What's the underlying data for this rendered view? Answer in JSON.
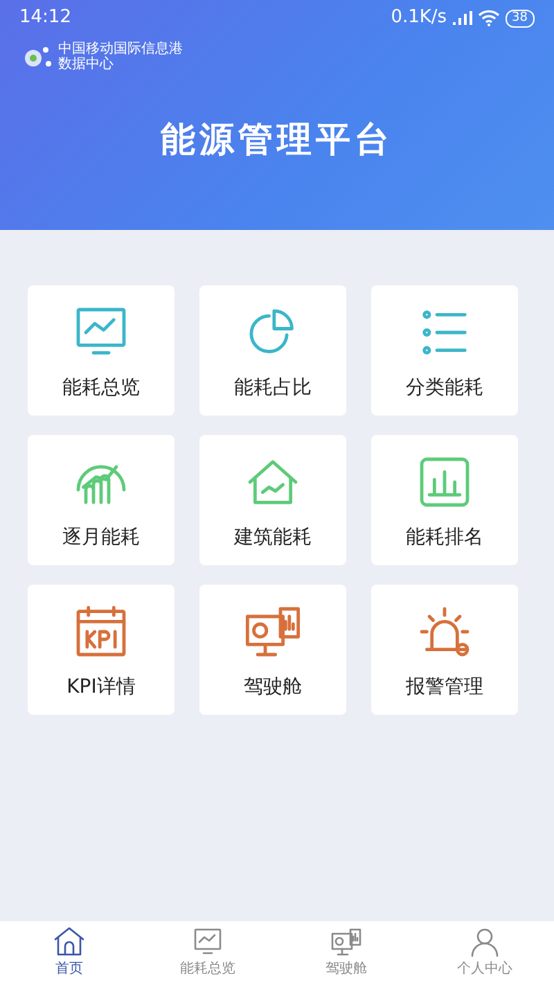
{
  "status_bar": {
    "time": "14:12",
    "speed": "0.1K/s",
    "battery": "38"
  },
  "header": {
    "logo_line_1": "中国移动国际信息港",
    "logo_line_2": "数据中心",
    "title": "能源管理平台"
  },
  "tiles": [
    {
      "label": "能耗总览",
      "kind": "monitor",
      "color": "#3bb6c9"
    },
    {
      "label": "能耗占比",
      "kind": "pie",
      "color": "#3bb6c9"
    },
    {
      "label": "分类能耗",
      "kind": "list",
      "color": "#3bb6c9"
    },
    {
      "label": "逐月能耗",
      "kind": "growth",
      "color": "#5dcb79"
    },
    {
      "label": "建筑能耗",
      "kind": "house",
      "color": "#5dcb79"
    },
    {
      "label": "能耗排名",
      "kind": "bars",
      "color": "#5dcb79"
    },
    {
      "label": "KPI详情",
      "kind": "kpi",
      "color": "#d7703b"
    },
    {
      "label": "驾驶舱",
      "kind": "cockpit",
      "color": "#d7703b"
    },
    {
      "label": "报警管理",
      "kind": "alarm",
      "color": "#d7703b"
    }
  ],
  "tabbar": [
    {
      "label": "首页",
      "kind": "home",
      "selected": true
    },
    {
      "label": "能耗总览",
      "kind": "monitor",
      "selected": false
    },
    {
      "label": "驾驶舱",
      "kind": "cockpit",
      "selected": false
    },
    {
      "label": "个人中心",
      "kind": "person",
      "selected": false
    }
  ]
}
